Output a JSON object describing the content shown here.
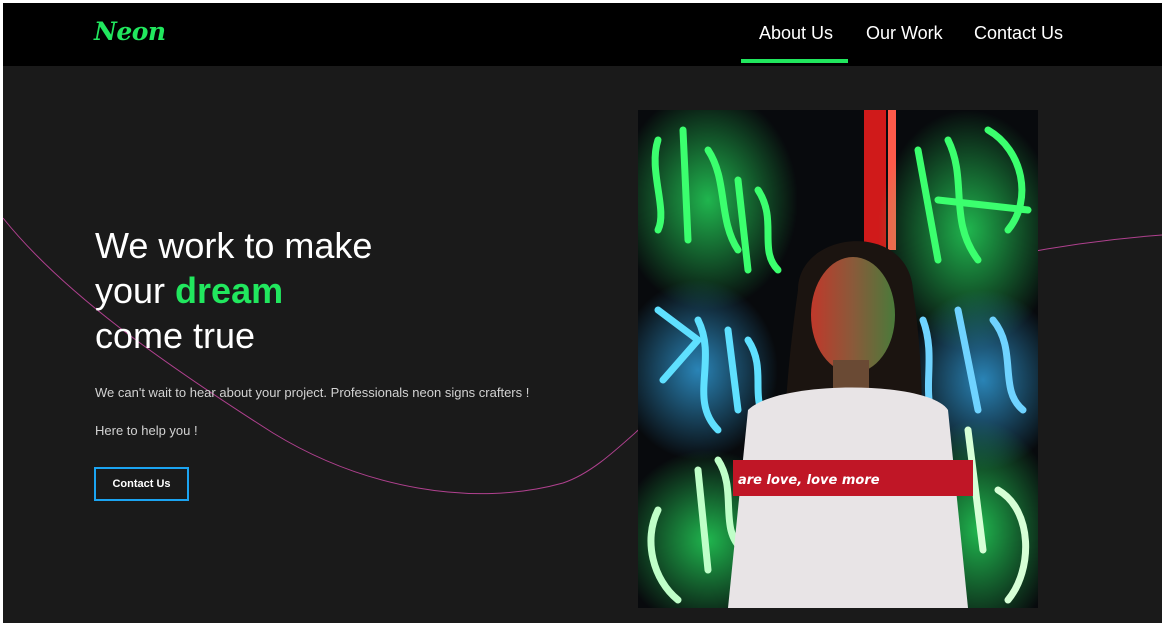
{
  "nav": {
    "logo": "Neon",
    "links": [
      "About Us",
      "Our Work",
      "Contact Us"
    ],
    "active_index": 0
  },
  "hero": {
    "headline_line1": "We work to make",
    "headline_line2_prefix": "your",
    "headline_accent": "dream",
    "headline_line3": "come true",
    "paragraph1": "We can't wait to hear about your project. Professionals neon signs crafters !",
    "paragraph2": "Here to help you !",
    "cta_label": "Contact Us",
    "shirt_text": "are love, love more"
  },
  "colors": {
    "accent": "#21e75e",
    "button_border": "#1ba4f2",
    "background": "#1a1a1a",
    "navbar": "#000000",
    "curve": "#b0418f"
  },
  "icons": {
    "hero_image": "neon-portrait-photo"
  }
}
